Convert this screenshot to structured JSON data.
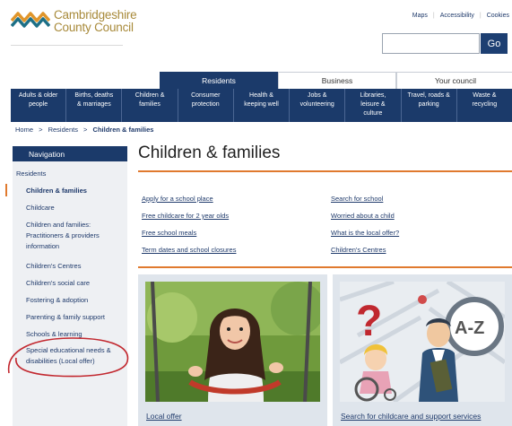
{
  "header": {
    "logo_line1": "Cambridgeshire",
    "logo_line2": "County Council",
    "top_links": [
      "Maps",
      "Accessibility",
      "Cookies"
    ],
    "search": {
      "placeholder": "",
      "button": "Go"
    }
  },
  "tabs": [
    {
      "label": "Residents",
      "active": true
    },
    {
      "label": "Business",
      "active": false
    },
    {
      "label": "Your council",
      "active": false
    }
  ],
  "categories": [
    [
      "Adults & older",
      "people"
    ],
    [
      "Births, deaths",
      "& marriages"
    ],
    [
      "Children &",
      "families"
    ],
    [
      "Consumer",
      "protection"
    ],
    [
      "Health &",
      "keeping well"
    ],
    [
      "Jobs &",
      "volunteering"
    ],
    [
      "Libraries,",
      "leisure &",
      "culture"
    ],
    [
      "Travel, roads &",
      "parking"
    ],
    [
      "Waste &",
      "recycling"
    ]
  ],
  "breadcrumb": {
    "home": "Home",
    "residents": "Residents",
    "current": "Children & families",
    "sep": ">"
  },
  "navigation": {
    "heading": "Navigation",
    "items": [
      [
        "Residents"
      ],
      [
        "Children & families"
      ],
      [
        "Childcare"
      ],
      [
        "Children and families:",
        "Practitioners & providers",
        "information"
      ],
      [
        "Children's Centres"
      ],
      [
        "Children's social care"
      ],
      [
        "Fostering & adoption"
      ],
      [
        "Parenting & family support"
      ],
      [
        "Schools & learning"
      ],
      [
        "Special educational needs &",
        "disabilities (Local offer)"
      ]
    ]
  },
  "main": {
    "title": "Children & families",
    "links": [
      "Apply for a school place",
      "Search for school",
      "Free childcare for 2 year olds",
      "Worried about a child",
      "Free school meals",
      "What is the local offer?",
      "Term dates and school closures",
      "Children's Centres"
    ],
    "cards": [
      {
        "label": "Local offer",
        "icon": "girl-on-swing-photo"
      },
      {
        "label": "Search for childcare and support services",
        "icon": "a-z-directory-illustration"
      }
    ],
    "az_text": "A-Z",
    "question_mark": "?"
  },
  "colors": {
    "navy": "#1b3a6a",
    "accent": "#e07a2f",
    "annotation": "#c2282f",
    "logo_gold": "#a88a3a"
  }
}
